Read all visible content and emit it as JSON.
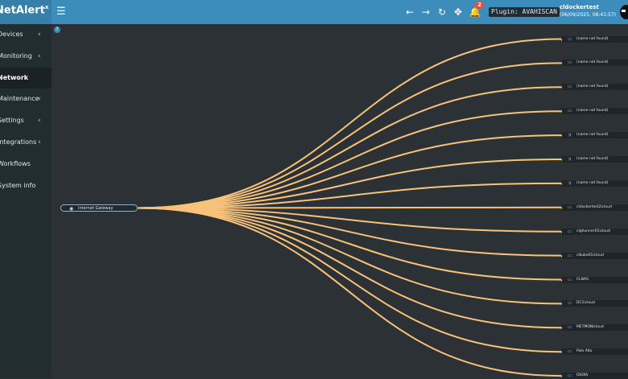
{
  "header": {
    "brand": "NetAlert",
    "brand_sup": "x",
    "menu_icon": "hamburger-icon",
    "nav_icons": [
      "arrow-left-icon",
      "arrow-right-icon",
      "refresh-icon",
      "move-arrows-icon",
      "bell-icon"
    ],
    "notification_count": "2",
    "plugin_label": "Plugin: AVAHISCAN",
    "user": {
      "name": "cldockertest",
      "datetime": "(06/09/2025, 08:41:57)"
    }
  },
  "sidebar": {
    "items": [
      {
        "label": "Devices",
        "has_chevron": true
      },
      {
        "label": "Monitoring",
        "has_chevron": true
      },
      {
        "label": "Network",
        "has_chevron": false,
        "active": true
      },
      {
        "label": "Maintenance",
        "has_chevron": true
      },
      {
        "label": "Settings",
        "has_chevron": true
      },
      {
        "label": "Integrations",
        "has_chevron": true
      },
      {
        "label": "Workflows",
        "has_chevron": false
      },
      {
        "label": "System info",
        "has_chevron": false
      }
    ]
  },
  "network": {
    "help_icon": "question-icon",
    "link_color": "#f7c37a",
    "root": {
      "label": "Internet Gateway",
      "icon": "globe-icon"
    },
    "leaves": [
      {
        "label": "(name not found)",
        "icon": "tv-icon"
      },
      {
        "label": "(name not found)",
        "icon": "tv-icon"
      },
      {
        "label": "(name not found)",
        "icon": "tv-icon"
      },
      {
        "label": "(name not found)",
        "icon": "tv-icon"
      },
      {
        "label": "(name not found)",
        "icon": "shuffle-icon"
      },
      {
        "label": "(name not found)",
        "icon": "shuffle-icon"
      },
      {
        "label": "(name not found)",
        "icon": "shuffle-icon"
      },
      {
        "label": "cldockertest2icloud",
        "icon": "tv-icon"
      },
      {
        "label": "clghunner01icloud",
        "icon": "tv-icon"
      },
      {
        "label": "clkube01icloud",
        "icon": "tv-icon"
      },
      {
        "label": "CLNAS",
        "icon": "tv-icon"
      },
      {
        "label": "DC1icloud",
        "icon": "tv-icon"
      },
      {
        "label": "METMONicloud",
        "icon": "tv-icon"
      },
      {
        "label": "Palo Alto",
        "icon": "tv-icon"
      },
      {
        "label": "IDGNS",
        "icon": "tv-icon"
      }
    ]
  }
}
